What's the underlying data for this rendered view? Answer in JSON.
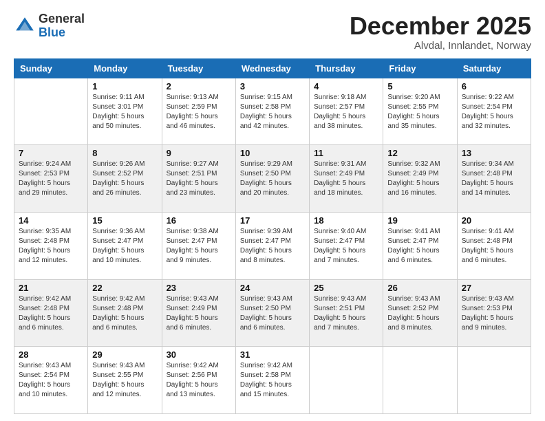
{
  "logo": {
    "general": "General",
    "blue": "Blue"
  },
  "header": {
    "month": "December 2025",
    "location": "Alvdal, Innlandet, Norway"
  },
  "weekdays": [
    "Sunday",
    "Monday",
    "Tuesday",
    "Wednesday",
    "Thursday",
    "Friday",
    "Saturday"
  ],
  "weeks": [
    [
      {
        "day": "",
        "info": ""
      },
      {
        "day": "1",
        "info": "Sunrise: 9:11 AM\nSunset: 3:01 PM\nDaylight: 5 hours\nand 50 minutes."
      },
      {
        "day": "2",
        "info": "Sunrise: 9:13 AM\nSunset: 2:59 PM\nDaylight: 5 hours\nand 46 minutes."
      },
      {
        "day": "3",
        "info": "Sunrise: 9:15 AM\nSunset: 2:58 PM\nDaylight: 5 hours\nand 42 minutes."
      },
      {
        "day": "4",
        "info": "Sunrise: 9:18 AM\nSunset: 2:57 PM\nDaylight: 5 hours\nand 38 minutes."
      },
      {
        "day": "5",
        "info": "Sunrise: 9:20 AM\nSunset: 2:55 PM\nDaylight: 5 hours\nand 35 minutes."
      },
      {
        "day": "6",
        "info": "Sunrise: 9:22 AM\nSunset: 2:54 PM\nDaylight: 5 hours\nand 32 minutes."
      }
    ],
    [
      {
        "day": "7",
        "info": "Sunrise: 9:24 AM\nSunset: 2:53 PM\nDaylight: 5 hours\nand 29 minutes."
      },
      {
        "day": "8",
        "info": "Sunrise: 9:26 AM\nSunset: 2:52 PM\nDaylight: 5 hours\nand 26 minutes."
      },
      {
        "day": "9",
        "info": "Sunrise: 9:27 AM\nSunset: 2:51 PM\nDaylight: 5 hours\nand 23 minutes."
      },
      {
        "day": "10",
        "info": "Sunrise: 9:29 AM\nSunset: 2:50 PM\nDaylight: 5 hours\nand 20 minutes."
      },
      {
        "day": "11",
        "info": "Sunrise: 9:31 AM\nSunset: 2:49 PM\nDaylight: 5 hours\nand 18 minutes."
      },
      {
        "day": "12",
        "info": "Sunrise: 9:32 AM\nSunset: 2:49 PM\nDaylight: 5 hours\nand 16 minutes."
      },
      {
        "day": "13",
        "info": "Sunrise: 9:34 AM\nSunset: 2:48 PM\nDaylight: 5 hours\nand 14 minutes."
      }
    ],
    [
      {
        "day": "14",
        "info": "Sunrise: 9:35 AM\nSunset: 2:48 PM\nDaylight: 5 hours\nand 12 minutes."
      },
      {
        "day": "15",
        "info": "Sunrise: 9:36 AM\nSunset: 2:47 PM\nDaylight: 5 hours\nand 10 minutes."
      },
      {
        "day": "16",
        "info": "Sunrise: 9:38 AM\nSunset: 2:47 PM\nDaylight: 5 hours\nand 9 minutes."
      },
      {
        "day": "17",
        "info": "Sunrise: 9:39 AM\nSunset: 2:47 PM\nDaylight: 5 hours\nand 8 minutes."
      },
      {
        "day": "18",
        "info": "Sunrise: 9:40 AM\nSunset: 2:47 PM\nDaylight: 5 hours\nand 7 minutes."
      },
      {
        "day": "19",
        "info": "Sunrise: 9:41 AM\nSunset: 2:47 PM\nDaylight: 5 hours\nand 6 minutes."
      },
      {
        "day": "20",
        "info": "Sunrise: 9:41 AM\nSunset: 2:48 PM\nDaylight: 5 hours\nand 6 minutes."
      }
    ],
    [
      {
        "day": "21",
        "info": "Sunrise: 9:42 AM\nSunset: 2:48 PM\nDaylight: 5 hours\nand 6 minutes."
      },
      {
        "day": "22",
        "info": "Sunrise: 9:42 AM\nSunset: 2:48 PM\nDaylight: 5 hours\nand 6 minutes."
      },
      {
        "day": "23",
        "info": "Sunrise: 9:43 AM\nSunset: 2:49 PM\nDaylight: 5 hours\nand 6 minutes."
      },
      {
        "day": "24",
        "info": "Sunrise: 9:43 AM\nSunset: 2:50 PM\nDaylight: 5 hours\nand 6 minutes."
      },
      {
        "day": "25",
        "info": "Sunrise: 9:43 AM\nSunset: 2:51 PM\nDaylight: 5 hours\nand 7 minutes."
      },
      {
        "day": "26",
        "info": "Sunrise: 9:43 AM\nSunset: 2:52 PM\nDaylight: 5 hours\nand 8 minutes."
      },
      {
        "day": "27",
        "info": "Sunrise: 9:43 AM\nSunset: 2:53 PM\nDaylight: 5 hours\nand 9 minutes."
      }
    ],
    [
      {
        "day": "28",
        "info": "Sunrise: 9:43 AM\nSunset: 2:54 PM\nDaylight: 5 hours\nand 10 minutes."
      },
      {
        "day": "29",
        "info": "Sunrise: 9:43 AM\nSunset: 2:55 PM\nDaylight: 5 hours\nand 12 minutes."
      },
      {
        "day": "30",
        "info": "Sunrise: 9:42 AM\nSunset: 2:56 PM\nDaylight: 5 hours\nand 13 minutes."
      },
      {
        "day": "31",
        "info": "Sunrise: 9:42 AM\nSunset: 2:58 PM\nDaylight: 5 hours\nand 15 minutes."
      },
      {
        "day": "",
        "info": ""
      },
      {
        "day": "",
        "info": ""
      },
      {
        "day": "",
        "info": ""
      }
    ]
  ]
}
